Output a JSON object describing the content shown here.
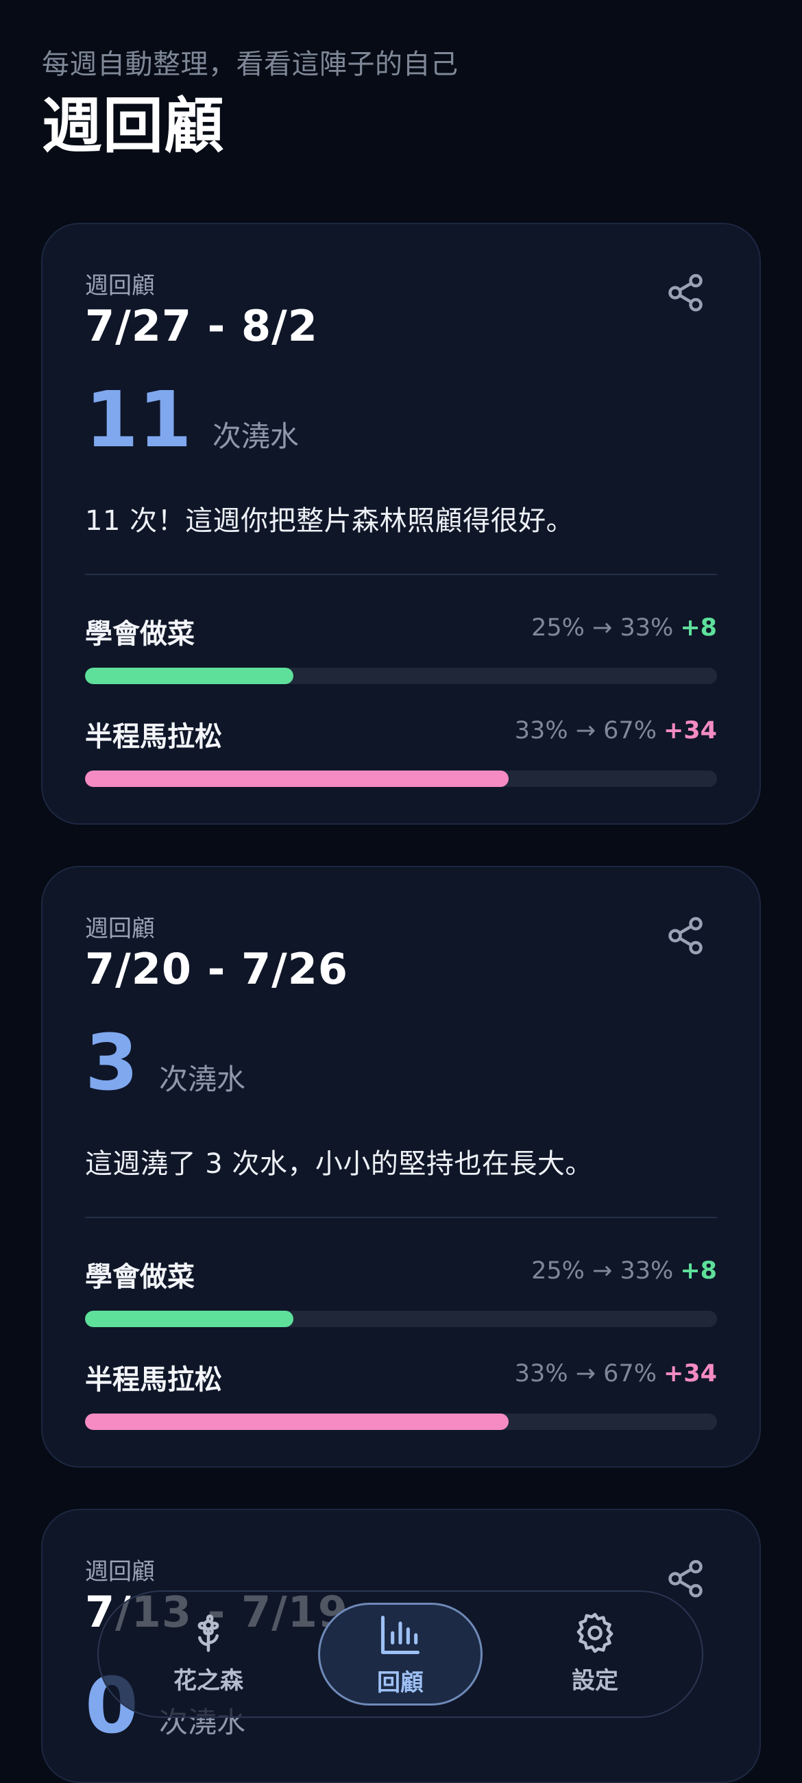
{
  "header": {
    "subtitle": "每週自動整理，看看這陣子的自己",
    "title": "週回顧"
  },
  "cards": [
    {
      "label": "週回顧",
      "range": "7/27 - 8/2",
      "count": "11",
      "count_unit": "次澆水",
      "message": "11 次！這週你把整片森林照顧得很好。",
      "goals": [
        {
          "name": "學會做菜",
          "stats": "25% → 33%",
          "delta": "+8",
          "progress": 0.33,
          "color": "green"
        },
        {
          "name": "半程馬拉松",
          "stats": "33% → 67%",
          "delta": "+34",
          "progress": 0.67,
          "color": "pink"
        }
      ]
    },
    {
      "label": "週回顧",
      "range": "7/20 - 7/26",
      "count": "3",
      "count_unit": "次澆水",
      "message": "這週澆了 3 次水，小小的堅持也在長大。",
      "goals": [
        {
          "name": "學會做菜",
          "stats": "25% → 33%",
          "delta": "+8",
          "progress": 0.33,
          "color": "green"
        },
        {
          "name": "半程馬拉松",
          "stats": "33% → 67%",
          "delta": "+34",
          "progress": 0.67,
          "color": "pink"
        }
      ]
    },
    {
      "label": "週回顧",
      "range": "7/13 - 7/19",
      "count": "0",
      "count_unit": "次澆水"
    }
  ],
  "icons": {
    "share": "share-icon",
    "forest": "flower-icon",
    "review": "bar-chart-icon",
    "settings": "gear-icon"
  },
  "nav": {
    "items": [
      {
        "label": "花之森",
        "icon": "flower-icon",
        "active": false
      },
      {
        "label": "回顧",
        "icon": "bar-chart-icon",
        "active": true
      },
      {
        "label": "設定",
        "icon": "gear-icon",
        "active": false
      }
    ]
  },
  "colors": {
    "accent_blue": "#7fa8ef",
    "progress_green": "#5ee09b",
    "progress_pink": "#f58bc2",
    "background": "#060b15",
    "card": "#0f1628"
  }
}
